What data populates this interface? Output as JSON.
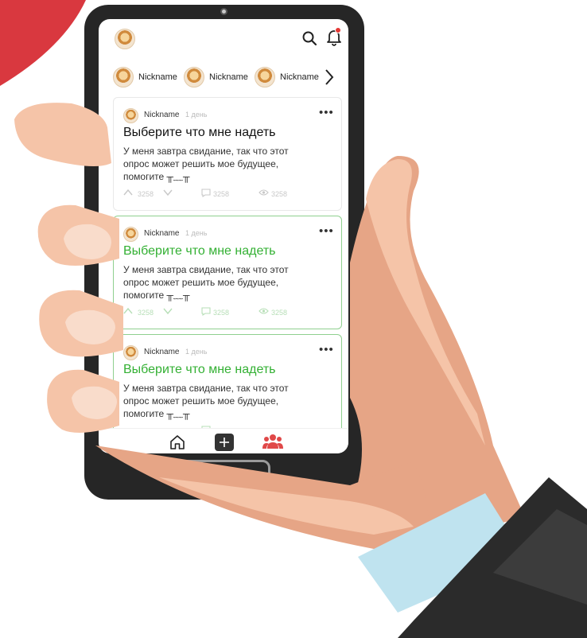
{
  "colors": {
    "accent_green": "#33b033",
    "badge_red": "#e53935",
    "nav_active_red": "#e04848"
  },
  "icons": {
    "header": [
      "avatar",
      "search-icon",
      "bell-icon"
    ],
    "stories_next": "chevron-right-icon",
    "post_menu": "more-horizontal-icon",
    "stats": [
      "upvote-icon",
      "downvote-icon",
      "comment-icon",
      "eye-icon"
    ],
    "nav": [
      "home-icon",
      "plus-icon",
      "users-icon"
    ]
  },
  "stories": [
    {
      "label": "Nickname"
    },
    {
      "label": "Nickname"
    },
    {
      "label": "Nickname"
    }
  ],
  "posts": [
    {
      "author": "Nickname",
      "time": "1 день",
      "menu": "•••",
      "title": "Выберите что мне надеть",
      "body": "У меня завтра свидание, так что этот опрос может решить мое будущее, помогите ╥﹏╥",
      "votes": "3258",
      "comments": "3258",
      "views": "3258"
    },
    {
      "author": "Nickname",
      "time": "1 день",
      "menu": "•••",
      "title": "Выберите что мне надеть",
      "body": "У меня завтра свидание, так что этот опрос может решить мое будущее, помогите ╥﹏╥",
      "votes": "3258",
      "comments": "3258",
      "views": "3258"
    },
    {
      "author": "Nickname",
      "time": "1 день",
      "menu": "•••",
      "title": "Выберите что мне надеть",
      "body": "У меня завтра свидание, так что этот опрос может решить мое будущее, помогите ╥﹏╥",
      "votes": "",
      "comments": "",
      "views": ""
    }
  ],
  "bottom_nav": {
    "add_label": "+"
  }
}
